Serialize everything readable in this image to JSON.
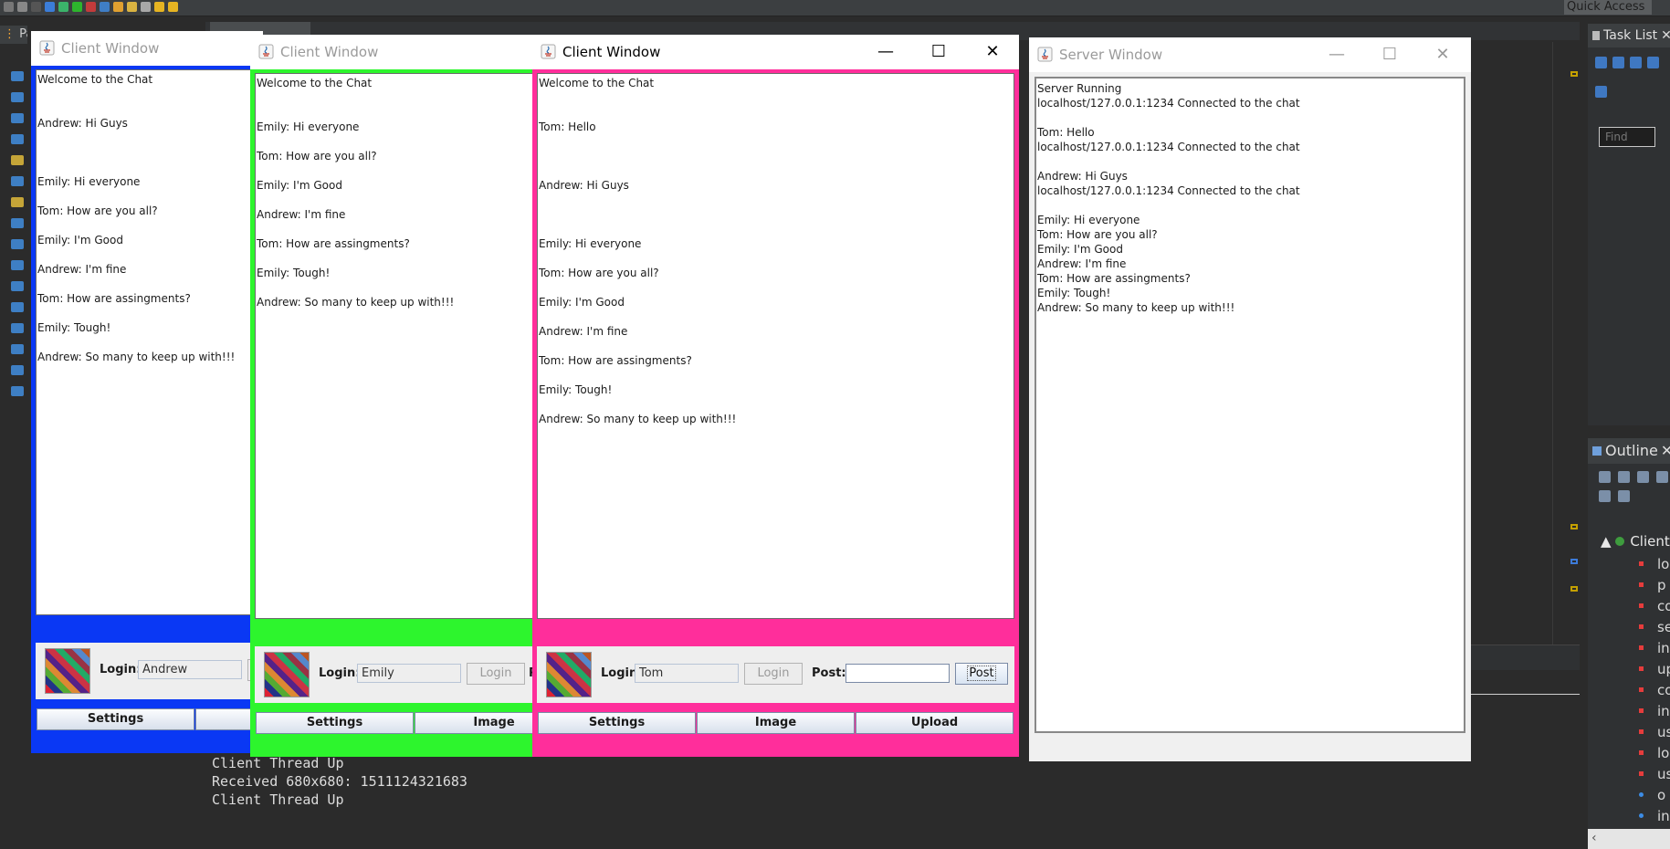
{
  "ide": {
    "quick_access": "Quick Access",
    "left_tab": "Pac",
    "task_list_label": "Task List",
    "find_placeholder": "Find",
    "outline_label": "Outline",
    "outline_root": "Client",
    "outline_items": [
      "lo",
      "p",
      "co",
      "se",
      "in",
      "up",
      "co",
      "in",
      "us",
      "lo",
      "us",
      "o",
      "in"
    ],
    "console_lines": [
      "Client Thread Up",
      "Received 680x680: 1511124321683",
      "Client Thread Up"
    ]
  },
  "client_blue": {
    "title": "Client Window",
    "accent": "#0a38f4",
    "messages": [
      "Welcome to the Chat",
      "Andrew: Hi Guys",
      "Emily: Hi everyone",
      "Tom: How are you all?",
      "Emily: I'm Good",
      "Andrew: I'm fine",
      "Tom: How are assingments?",
      "Emily: Tough!",
      "Andrew: So many to keep up with!!!"
    ],
    "login_label": "Login:",
    "login_value": "Andrew",
    "settings_label": "Settings"
  },
  "client_green": {
    "title": "Client Window",
    "accent": "#2df52d",
    "messages": [
      "Welcome to the Chat",
      "Emily: Hi everyone",
      "Tom: How are you all?",
      "Emily: I'm Good",
      "Andrew: I'm fine",
      "Tom: How are assingments?",
      "Emily: Tough!",
      "Andrew: So many to keep up with!!!"
    ],
    "login_label": "Login:",
    "login_value": "Emily",
    "login_button": "Login",
    "post_label_partial": "P",
    "settings_label": "Settings",
    "image_label": "Image"
  },
  "client_pink": {
    "title": "Client Window",
    "accent": "#ff2e9b",
    "minimize": "—",
    "maximize": "☐",
    "close": "✕",
    "messages": [
      "Welcome to the Chat",
      "Tom: Hello",
      "Andrew: Hi Guys",
      "Emily: Hi everyone",
      "Tom: How are you all?",
      "Emily: I'm Good",
      "Andrew: I'm fine",
      "Tom: How are assingments?",
      "Emily: Tough!",
      "Andrew: So many to keep up with!!!"
    ],
    "login_label": "Login:",
    "login_value": "Tom",
    "login_button": "Login",
    "post_label": "Post:",
    "post_value": "",
    "post_button": "Post",
    "settings_label": "Settings",
    "image_label": "Image",
    "upload_label": "Upload"
  },
  "server": {
    "title": "Server Window",
    "minimize": "—",
    "maximize": "☐",
    "close": "✕",
    "log": [
      "Server Running",
      "localhost/127.0.0.1:1234 Connected to the chat",
      "",
      "Tom: Hello",
      "localhost/127.0.0.1:1234 Connected to the chat",
      "",
      "Andrew: Hi Guys",
      "localhost/127.0.0.1:1234 Connected to the chat",
      "",
      "Emily: Hi everyone",
      "Tom: How are you all?",
      "Emily: I'm Good",
      "Andrew: I'm fine",
      "Tom: How are assingments?",
      "Emily: Tough!",
      "Andrew: So many to keep up with!!!"
    ]
  }
}
